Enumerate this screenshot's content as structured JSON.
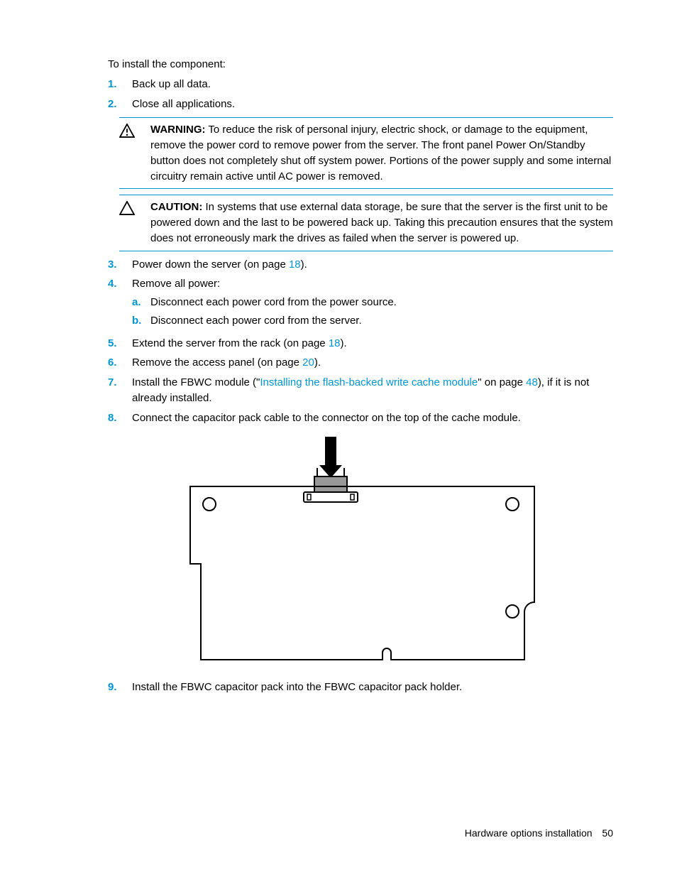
{
  "intro": "To install the component:",
  "steps": {
    "s1": {
      "num": "1.",
      "text": "Back up all data."
    },
    "s2": {
      "num": "2.",
      "text": "Close all applications."
    },
    "s3": {
      "num": "3.",
      "pre": "Power down the server (on page ",
      "link": "18",
      "post": ")."
    },
    "s4": {
      "num": "4.",
      "text": "Remove all power:",
      "a": {
        "letter": "a.",
        "text": "Disconnect each power cord from the power source."
      },
      "b": {
        "letter": "b.",
        "text": "Disconnect each power cord from the server."
      }
    },
    "s5": {
      "num": "5.",
      "pre": "Extend the server from the rack (on page ",
      "link": "18",
      "post": ")."
    },
    "s6": {
      "num": "6.",
      "pre": "Remove the access panel (on page ",
      "link": "20",
      "post": ")."
    },
    "s7": {
      "num": "7.",
      "pre": "Install the FBWC module (\"",
      "link1": "Installing the flash-backed write cache module",
      "mid": "\" on page ",
      "link2": "48",
      "post": "), if it is not already installed."
    },
    "s8": {
      "num": "8.",
      "text": "Connect the capacitor pack cable to the connector on the top of the cache module."
    },
    "s9": {
      "num": "9.",
      "text": "Install the FBWC capacitor pack into the FBWC capacitor pack holder."
    }
  },
  "warning": {
    "label": "WARNING:",
    "text": " To reduce the risk of personal injury, electric shock, or damage to the equipment, remove the power cord to remove power from the server. The front panel Power On/Standby button does not completely shut off system power. Portions of the power supply and some internal circuitry remain active until AC power is removed."
  },
  "caution": {
    "label": "CAUTION:",
    "text": " In systems that use external data storage, be sure that the server is the first unit to be powered down and the last to be powered back up. Taking this precaution ensures that the system does not erroneously mark the drives as failed when the server is powered up."
  },
  "footer": {
    "section": "Hardware options installation",
    "page": "50"
  }
}
